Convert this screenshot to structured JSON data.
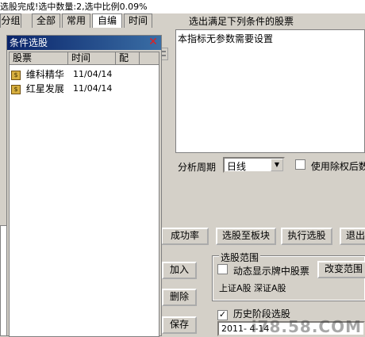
{
  "status_text": "选股完成!选中数量:2,选中比例0.09%",
  "tabs": [
    {
      "label": "分组"
    },
    {
      "label": "全部"
    },
    {
      "label": "常用"
    },
    {
      "label": "自编"
    },
    {
      "label": "时间"
    }
  ],
  "caption": "选出满足下列条件的股票",
  "description": "本指标无参数需要设置",
  "analysis_period_label": "分析周期",
  "analysis_period_value": "日线",
  "use_adjust_label": "使用除权后数",
  "buttons": {
    "success_rate": "成功率",
    "to_sector": "选股至板块",
    "execute": "执行选股",
    "exit": "退出",
    "add": "加入",
    "delete": "删除",
    "save": "保存",
    "change_range": "改变范围"
  },
  "range_group_label": "选股范围",
  "dynamic_label": "动态显示牌中股票",
  "range_text": "上证A股 深证A股",
  "history_label": "历史阶段选股",
  "date_value": "2011- 4-14",
  "dialog": {
    "title": "条件选股",
    "columns": [
      "股票",
      "时间",
      "配"
    ],
    "rows": [
      {
        "name": "维科精华",
        "date": "11/04/14"
      },
      {
        "name": "红星发展",
        "date": "11/04/14"
      }
    ]
  },
  "watermark_text": "i78.58.COM",
  "history_checked": true
}
